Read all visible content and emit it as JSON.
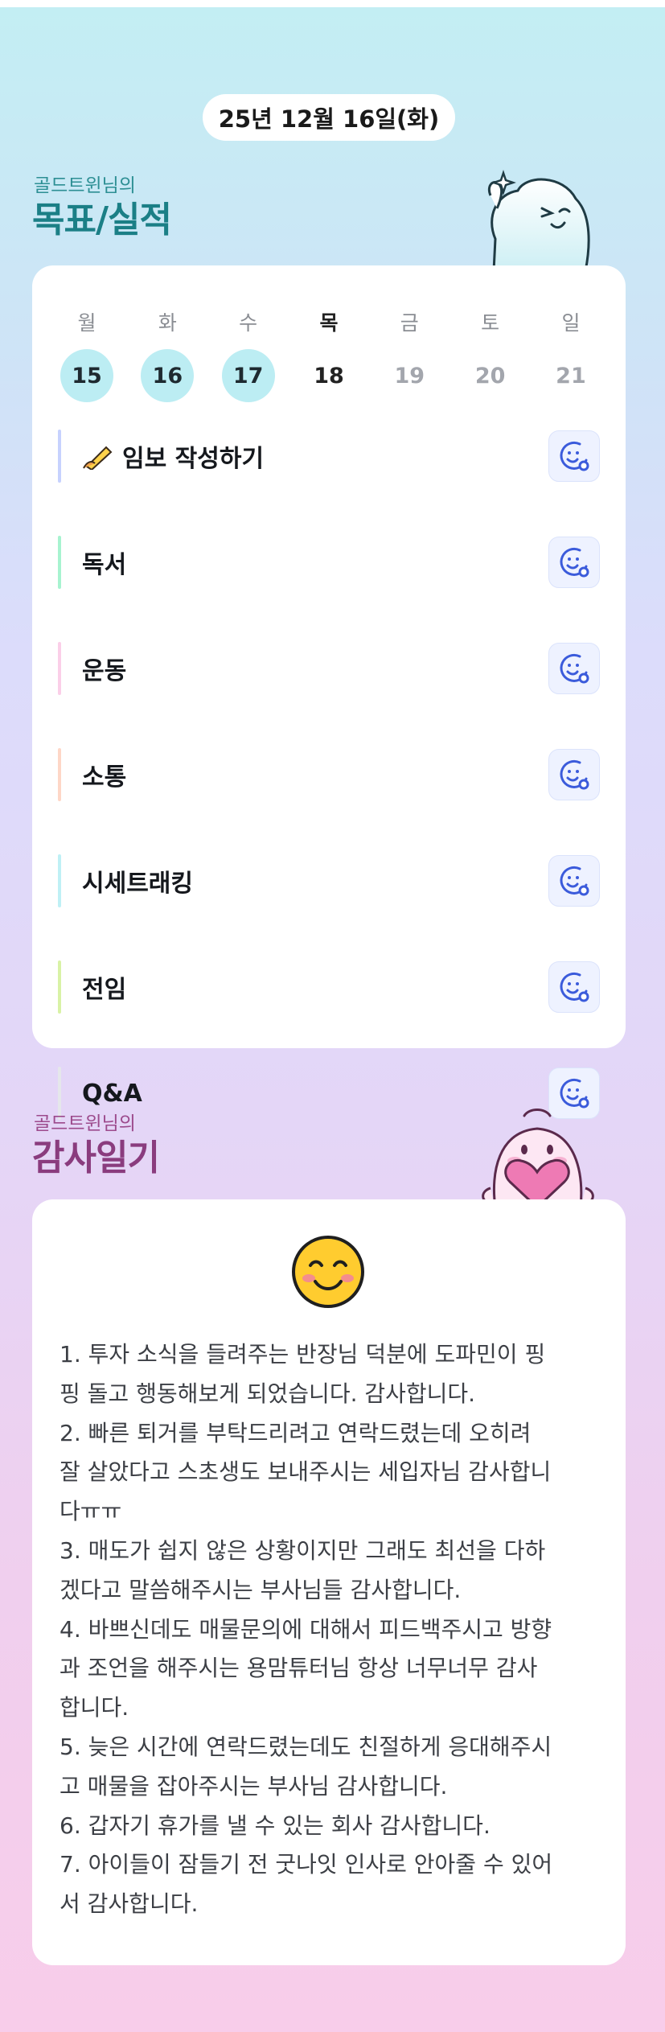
{
  "date": "25년 12월 16일(화)",
  "goals_section": {
    "owner": "골드트윈님의",
    "title": "목표/실적"
  },
  "week": {
    "days": [
      "월",
      "화",
      "수",
      "목",
      "금",
      "토",
      "일"
    ],
    "dates": [
      "15",
      "16",
      "17",
      "18",
      "19",
      "20",
      "21"
    ],
    "completed": [
      true,
      true,
      true,
      false,
      false,
      false,
      false
    ],
    "today_index": 3
  },
  "goals": [
    {
      "label": "임보 작성하기",
      "icon": "writing-hand-icon",
      "bar_color": "#c7d2fe"
    },
    {
      "label": "독서",
      "bar_color": "#a7f3d0"
    },
    {
      "label": "운동",
      "bar_color": "#fbcfe8"
    },
    {
      "label": "소통",
      "bar_color": "#fed7c7"
    },
    {
      "label": "시세트래킹",
      "bar_color": "#bff0f5"
    },
    {
      "label": "전임",
      "bar_color": "#d9f2a6"
    },
    {
      "label": "Q&A",
      "bar_color": "#e5e7eb"
    }
  ],
  "reaction_icon": "smile-add-icon",
  "diary_section": {
    "owner": "골드트윈님의",
    "title": "감사일기"
  },
  "diary": {
    "mood_icon": "smiling-face-icon",
    "text": "1. 투자 소식을 들려주는 반장님 덕분에 도파민이 핑\n핑 돌고 행동해보게 되었습니다. 감사합니다.\n2. 빠른 퇴거를 부탁드리려고 연락드렸는데 오히려\n잘 살았다고 스초생도 보내주시는 세입자님 감사합니\n다ㅠㅠ\n3. 매도가 쉽지 않은 상황이지만 그래도 최선을 다하\n겠다고 말씀해주시는 부사님들 감사합니다.\n4. 바쁘신데도 매물문의에 대해서 피드백주시고 방향\n과 조언을 해주시는 용맘튜터님 항상 너무너무 감사\n합니다.\n5. 늦은 시간에 연락드렸는데도 친절하게 응대해주시\n고 매물을 잡아주시는 부사님 감사합니다.\n6. 갑자기 휴가를 낼 수 있는 회사 감사합니다.\n7. 아이들이 잠들기 전 굿나잇 인사로 안아줄 수 있어\n서 감사합니다."
  },
  "colors": {
    "goals_title": "#1b7f86",
    "goals_owner": "#2d8f94",
    "diary_title": "#8a3c7e",
    "diary_owner": "#9c4a8c",
    "done_circle": "#bcedf3",
    "reaction_icon": "#3b5bdb"
  }
}
